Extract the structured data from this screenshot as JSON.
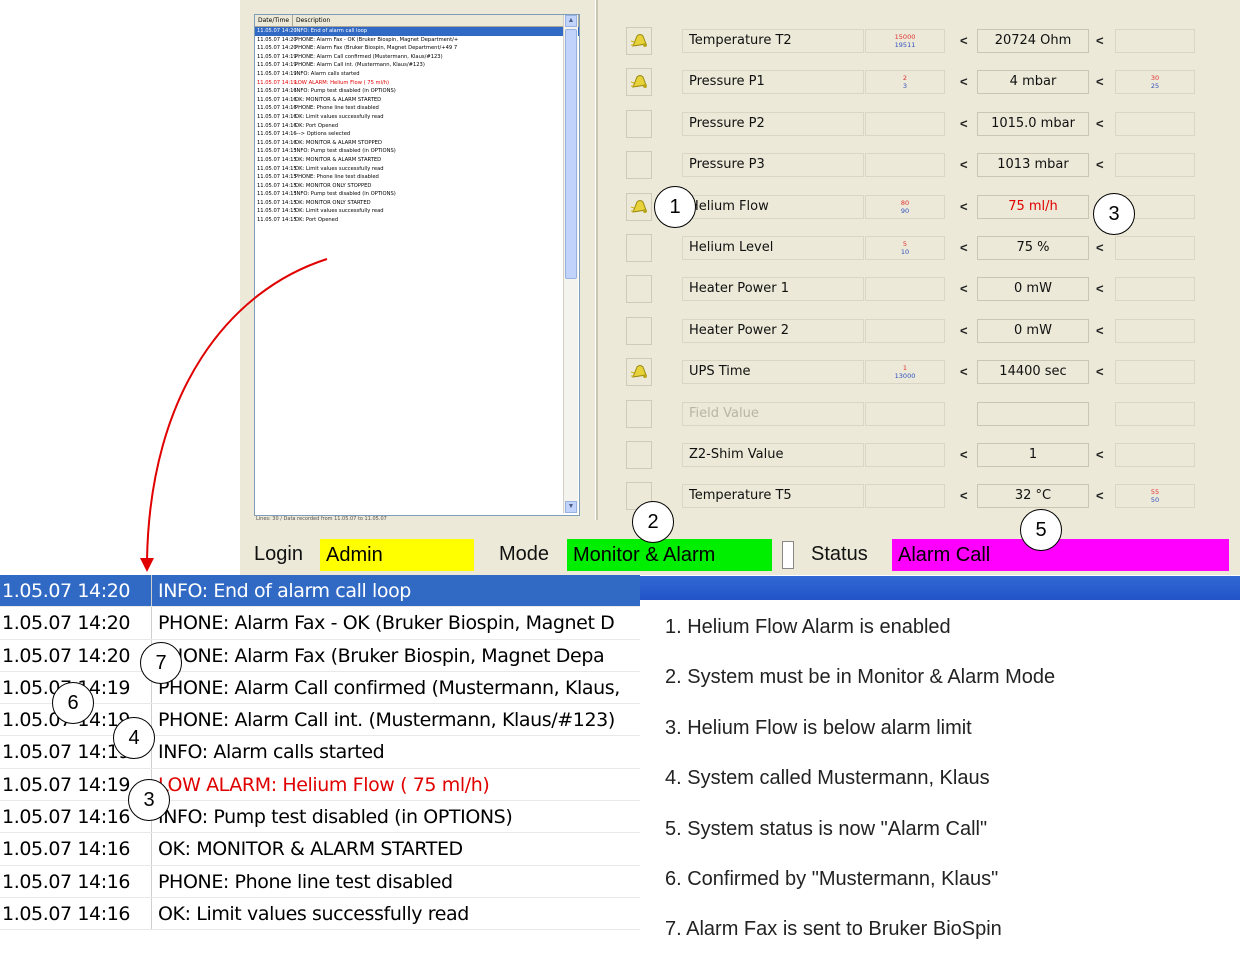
{
  "log_small": {
    "header": {
      "date": "Date/Time",
      "desc": "Description"
    },
    "rows": [
      {
        "d": "11.05.07 14:20",
        "m": "INFO: End of alarm call loop",
        "sel": true
      },
      {
        "d": "11.05.07 14:20",
        "m": "PHONE: Alarm Fax - OK (Bruker Biospin, Magnet Department/+"
      },
      {
        "d": "11.05.07 14:20",
        "m": "PHONE: Alarm Fax (Bruker Biospin, Magnet Department/+49 7"
      },
      {
        "d": "11.05.07 14:19",
        "m": "PHONE: Alarm Call confirmed (Mustermann, Klaus/#123)"
      },
      {
        "d": "11.05.07 14:19",
        "m": "PHONE: Alarm Call int. (Mustermann, Klaus/#123)"
      },
      {
        "d": "11.05.07 14:19",
        "m": "INFO: Alarm calls started"
      },
      {
        "d": "11.05.07 14:19",
        "m": "LOW ALARM: Helium Flow ( 75 ml/h)",
        "red": true
      },
      {
        "d": "11.05.07 14:16",
        "m": "INFO: Pump test disabled (in OPTIONS)"
      },
      {
        "d": "11.05.07 14:16",
        "m": "OK: MONITOR & ALARM STARTED"
      },
      {
        "d": "11.05.07 14:16",
        "m": "PHONE: Phone line test disabled"
      },
      {
        "d": "11.05.07 14:16",
        "m": "OK: Limit values successfully read"
      },
      {
        "d": "11.05.07 14:16",
        "m": "OK: Port Opened"
      },
      {
        "d": "11.05.07 14:16",
        "m": "---> Options selected"
      },
      {
        "d": "11.05.07 14:16",
        "m": "OK: MONITOR & ALARM STOPPED"
      },
      {
        "d": "11.05.07 14:15",
        "m": "INFO: Pump test disabled (in OPTIONS)"
      },
      {
        "d": "11.05.07 14:15",
        "m": "OK: MONITOR & ALARM STARTED"
      },
      {
        "d": "11.05.07 14:15",
        "m": "OK: Limit values successfully read"
      },
      {
        "d": "11.05.07 14:15",
        "m": "PHONE: Phone line test disabled"
      },
      {
        "d": "11.05.07 14:15",
        "m": "OK: MONITOR ONLY STOPPED"
      },
      {
        "d": "11.05.07 14:15",
        "m": "INFO: Pump test disabled (in OPTIONS)"
      },
      {
        "d": "11.05.07 14:15",
        "m": "OK: MONITOR ONLY STARTED"
      },
      {
        "d": "11.05.07 14:15",
        "m": "OK: Limit values successfully read"
      },
      {
        "d": "11.05.07 14:15",
        "m": "OK: Port Opened"
      }
    ],
    "footer": "Lines: 30 / Data recorded from 11.05.07 to 11.05.07"
  },
  "monitor": {
    "less_than": "<",
    "rows": [
      {
        "label": "Temperature T2",
        "value": "20724 Ohm",
        "low_a": "15000",
        "low_b": "19511",
        "high_a": "",
        "high_b": "",
        "alarm": true
      },
      {
        "label": "Pressure P1",
        "value": "4 mbar",
        "low_a": "2",
        "low_b": "3",
        "high_a": "30",
        "high_b": "25",
        "alarm": true
      },
      {
        "label": "Pressure P2",
        "value": "1015.0 mbar",
        "low_a": "",
        "low_b": "",
        "high_a": "",
        "high_b": "",
        "alarm": false
      },
      {
        "label": "Pressure P3",
        "value": "1013 mbar",
        "low_a": "",
        "low_b": "",
        "high_a": "",
        "high_b": "",
        "alarm": false
      },
      {
        "label": "Helium Flow",
        "value": "75 ml/h",
        "low_a": "80",
        "low_b": "90",
        "high_a": "",
        "high_b": "",
        "alarm": true,
        "red": true
      },
      {
        "label": "Helium Level",
        "value": "75 %",
        "low_a": "5",
        "low_b": "10",
        "high_a": "",
        "high_b": "",
        "alarm": false
      },
      {
        "label": "Heater Power 1",
        "value": "0 mW",
        "low_a": "",
        "low_b": "",
        "high_a": "",
        "high_b": "",
        "alarm": false
      },
      {
        "label": "Heater Power 2",
        "value": "0 mW",
        "low_a": "",
        "low_b": "",
        "high_a": "",
        "high_b": "",
        "alarm": false
      },
      {
        "label": "UPS Time",
        "value": "14400 sec",
        "low_a": "1",
        "low_b": "13000",
        "high_a": "",
        "high_b": "",
        "alarm": true
      },
      {
        "label": "Field Value",
        "value": "",
        "low_a": "",
        "low_b": "",
        "high_a": "",
        "high_b": "",
        "alarm": false,
        "dim": true
      },
      {
        "label": "Z2-Shim Value",
        "value": "1",
        "low_a": "",
        "low_b": "",
        "high_a": "",
        "high_b": "",
        "alarm": false
      },
      {
        "label": "Temperature T5",
        "value": "32 °C",
        "low_a": "",
        "low_b": "",
        "high_a": "55",
        "high_b": "50",
        "alarm": false
      }
    ]
  },
  "status_bar": {
    "login_label": "Login",
    "login_value": "Admin",
    "mode_label": "Mode",
    "mode_value": "Monitor & Alarm",
    "status_label": "Status",
    "status_value": "Alarm Call",
    "colors": {
      "login": "#ffff00",
      "mode": "#00ee00",
      "status": "#ff00ff"
    }
  },
  "log_zoom": [
    {
      "d": "1.05.07 14:20",
      "m": "INFO: End of alarm call loop",
      "sel": true
    },
    {
      "d": "1.05.07 14:20",
      "m": "PHONE: Alarm Fax - OK (Bruker Biospin, Magnet D"
    },
    {
      "d": "1.05.07 14:20",
      "m": "PHONE: Alarm  Fax (Bruker Biospin, Magnet Depa"
    },
    {
      "d": "1.05.07 14:19",
      "m": "PHONE: Alarm Call confirmed (Mustermann, Klaus,"
    },
    {
      "d": "1.05.07 14:19",
      "m": "PHONE: Alarm Call int. (Mustermann, Klaus/#123)"
    },
    {
      "d": "1.05.07 14:19",
      "m": "INFO: Alarm calls started"
    },
    {
      "d": "1.05.07 14:19",
      "m": "LOW ALARM: Helium Flow ( 75 ml/h)",
      "red": true
    },
    {
      "d": "1.05.07 14:16",
      "m": "INFO: Pump test disabled (in OPTIONS)"
    },
    {
      "d": "1.05.07 14:16",
      "m": "OK: MONITOR & ALARM STARTED"
    },
    {
      "d": "1.05.07 14:16",
      "m": "PHONE: Phone line test disabled"
    },
    {
      "d": "1.05.07 14:16",
      "m": "OK: Limit values successfully read"
    }
  ],
  "callouts": [
    "1",
    "2",
    "3",
    "3",
    "4",
    "5",
    "6",
    "7"
  ],
  "notes": [
    "1. Helium Flow Alarm is enabled",
    "2. System must be in Monitor & Alarm Mode",
    "3. Helium Flow is below alarm limit",
    "4. System called Mustermann, Klaus",
    "5. System status is now \"Alarm Call\"",
    "6. Confirmed by \"Mustermann, Klaus\"",
    "7. Alarm Fax is sent to Bruker BioSpin"
  ],
  "colors": {
    "selection": "#316ac5",
    "alarm_text": "#e00000",
    "arrow": "#e00000"
  }
}
